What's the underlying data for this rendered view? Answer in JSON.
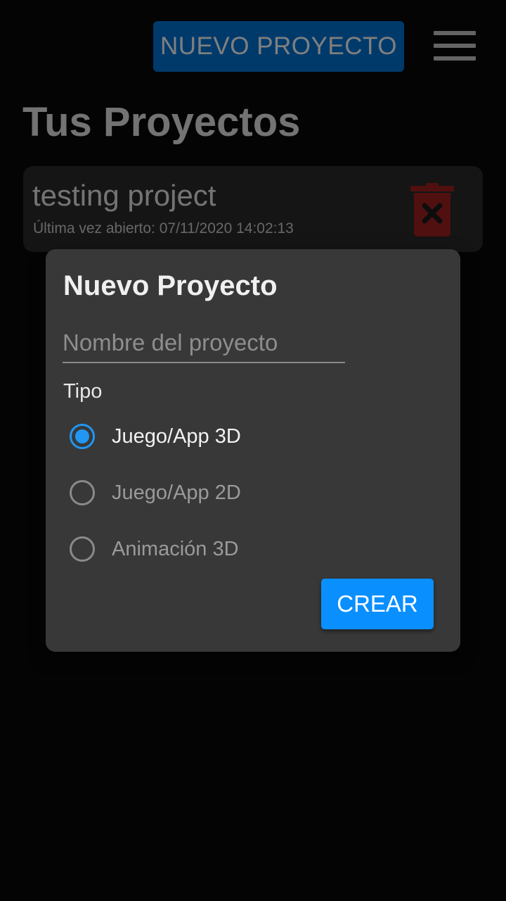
{
  "header": {
    "new_project_label": "NUEVO PROYECTO",
    "menu_icon": "hamburger-menu-icon"
  },
  "page": {
    "title": "Tus Proyectos"
  },
  "projects": [
    {
      "name": "testing project",
      "last_opened": "Última vez abierto: 07/11/2020 14:02:13",
      "delete_icon": "trash-icon"
    }
  ],
  "dialog": {
    "title": "Nuevo Proyecto",
    "name_placeholder": "Nombre del proyecto",
    "name_value": "",
    "type_label": "Tipo",
    "options": [
      {
        "label": "Juego/App 3D",
        "selected": true
      },
      {
        "label": "Juego/App 2D",
        "selected": false
      },
      {
        "label": "Animación 3D",
        "selected": false
      }
    ],
    "create_label": "CREAR"
  },
  "colors": {
    "accent": "#0a8fff",
    "radio_selected": "#2196f3",
    "trash": "#a32020",
    "background": "#080808",
    "dialog": "#383838"
  }
}
